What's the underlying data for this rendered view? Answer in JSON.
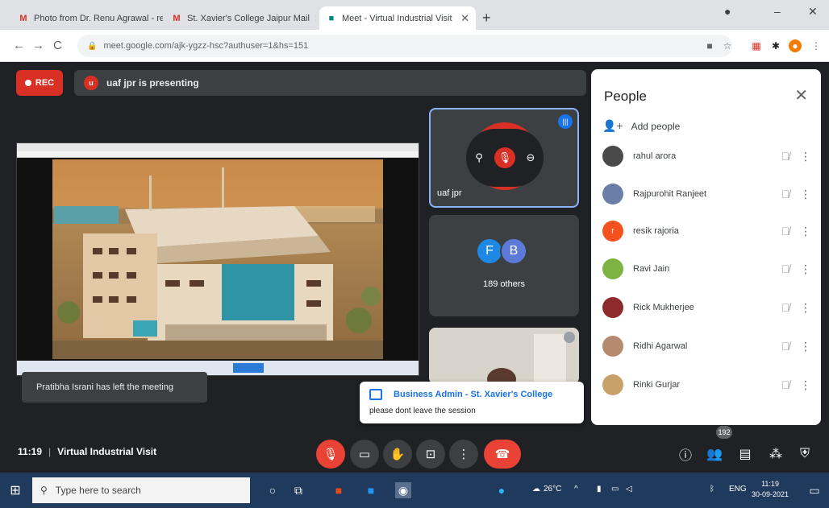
{
  "browser": {
    "tabs": [
      {
        "label": "Photo from Dr. Renu Agrawal - renujadon",
        "favicon": "gmail-icon",
        "active": false
      },
      {
        "label": "St. Xavier's College Jaipur Mail",
        "favicon": "gmail-icon",
        "active": false
      },
      {
        "label": "Meet - Virtual Industrial Visit",
        "favicon": "meet-icon",
        "active": true
      }
    ],
    "address": "meet.google.com/ajk-ygzz-hsc?authuser=1&hs=151"
  },
  "meet": {
    "rec_label": "REC",
    "presenting_text": "uaf jpr is presenting",
    "presenter_initial": "u",
    "presenter_tile_name": "uaf jpr",
    "others_avatars": [
      {
        "letter": "F",
        "color": "#1e88e5"
      },
      {
        "letter": "B",
        "color": "#5c7bd8"
      }
    ],
    "others_count_label": "189 others",
    "toast_left": "Pratibha Israni has left the meeting",
    "chat_toast": {
      "sender": "Business Admin - St. Xavier's College",
      "message": "please dont leave the session"
    },
    "meeting_time": "11:19",
    "meeting_title": "Virtual Industrial Visit",
    "people_count": "192"
  },
  "people_panel": {
    "title": "People",
    "add_people_label": "Add people",
    "people": [
      {
        "name": "rahul arora",
        "avatar_color": "#4a4a4a"
      },
      {
        "name": "Rajpurohit Ranjeet",
        "avatar_color": "#6a7fa8"
      },
      {
        "name": "resik rajoria",
        "avatar_color": "#f4511e",
        "initial": "r"
      },
      {
        "name": "Ravi Jain",
        "avatar_color": "#7cb342"
      },
      {
        "name": "Rick Mukherjee",
        "avatar_color": "#8d2a2a"
      },
      {
        "name": "Ridhi Agarwal",
        "avatar_color": "#b58a6e"
      },
      {
        "name": "Rinki Gurjar",
        "avatar_color": "#c9a06a"
      }
    ]
  },
  "taskbar": {
    "search_placeholder": "Type here to search",
    "weather": "26°C",
    "language": "ENG",
    "time": "11:19",
    "date": "30-09-2021"
  }
}
